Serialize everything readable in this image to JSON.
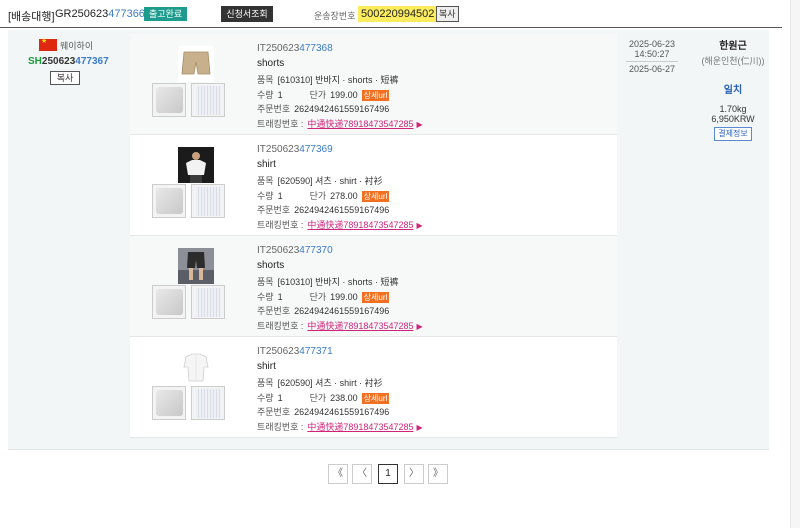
{
  "header": {
    "title": "[배송대행]",
    "gr_prefix": "GR250623",
    "gr_suffix": "477366",
    "status_badge": "출고완료",
    "request_btn": "신청서조회",
    "invoice_label": "운송장번호",
    "invoice_number": "500220994502",
    "copy_btn": "복사"
  },
  "left": {
    "carrier": "웨이하이",
    "sh_prefix": "SH",
    "sh_mid": "250623",
    "sh_suffix": "477367",
    "copy_btn": "복사"
  },
  "items": [
    {
      "id_prefix": "IT250623",
      "id_suffix": "477368",
      "name": "shorts",
      "lbl_item": "품목",
      "item": "[610310] 반바지 · shorts · 短裤",
      "lbl_qty": "수량",
      "qty": "1",
      "lbl_price": "단가",
      "price": "199.00",
      "detail": "상세url",
      "lbl_order": "주문번호",
      "order_no": "2624942461559167496",
      "lbl_track": "트래킹번호 :",
      "tracking": "中通快递78918473547285"
    },
    {
      "id_prefix": "IT250623",
      "id_suffix": "477369",
      "name": "shirt",
      "lbl_item": "품목",
      "item": "[620590] 셔츠 · shirt · 衬衫",
      "lbl_qty": "수량",
      "qty": "1",
      "lbl_price": "단가",
      "price": "278.00",
      "detail": "상세url",
      "lbl_order": "주문번호",
      "order_no": "2624942461559167496",
      "lbl_track": "트래킹번호 :",
      "tracking": "中通快递78918473547285"
    },
    {
      "id_prefix": "IT250623",
      "id_suffix": "477370",
      "name": "shorts",
      "lbl_item": "품목",
      "item": "[610310] 반바지 · shorts · 短裤",
      "lbl_qty": "수량",
      "qty": "1",
      "lbl_price": "단가",
      "price": "199.00",
      "detail": "상세url",
      "lbl_order": "주문번호",
      "order_no": "2624942461559167496",
      "lbl_track": "트래킹번호 :",
      "tracking": "中通快递78918473547285"
    },
    {
      "id_prefix": "IT250623",
      "id_suffix": "477371",
      "name": "shirt",
      "lbl_item": "품목",
      "item": "[620590] 셔츠 · shirt · 衬衫",
      "lbl_qty": "수량",
      "qty": "1",
      "lbl_price": "단가",
      "price": "238.00",
      "detail": "상세url",
      "lbl_order": "주문번호",
      "order_no": "2624942461559167496",
      "lbl_track": "트래킹번호 :",
      "tracking": "中通快递78918473547285"
    }
  ],
  "dates": {
    "request_date": "2025-06-23",
    "request_time": "14:50:27",
    "ship_date": "2025-06-27"
  },
  "right": {
    "name": "한원근",
    "sub": "(해운인천(仁川))",
    "match": "일치",
    "weight_val": "1.70",
    "weight_unit": "kg",
    "price_val": "6,950",
    "price_unit": "KRW",
    "pay_btn": "결제정보"
  },
  "pager": {
    "first": "《",
    "prev": "〈",
    "current": "1",
    "next": "〉",
    "last": "》"
  },
  "colors": {
    "badge": "#1d9b8d",
    "invoice_highlight": "#fcec5e",
    "id_link": "#3a7bc8",
    "sh_green": "#1a9b3b",
    "detail_orange": "#f37021",
    "tracking_pink": "#d0247b"
  }
}
